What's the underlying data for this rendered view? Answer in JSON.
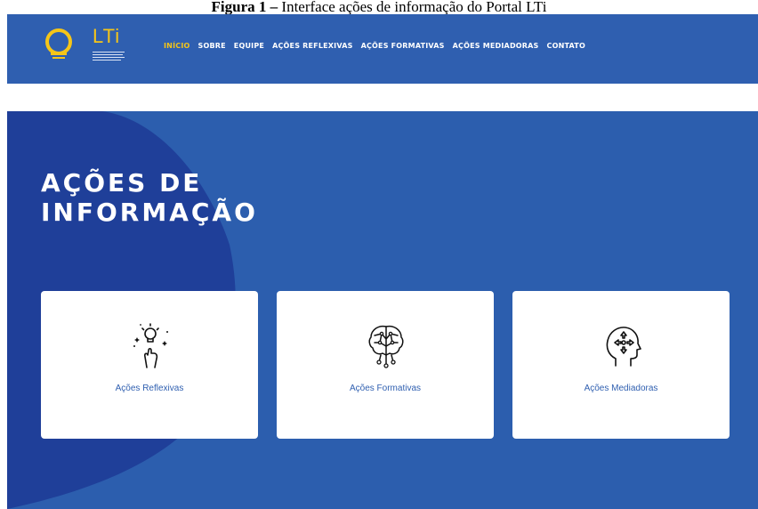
{
  "caption": {
    "bold": "Figura 1 –",
    "text": " Interface ações de informação do Portal LTi"
  },
  "colors": {
    "nav_bg": "#2f5fb0",
    "hero_bg": "#2c5eae",
    "hero_shape": "#1f3f99",
    "accent": "#f5c518",
    "card_text": "#2f5fb0"
  },
  "logo": {
    "text": "LTi",
    "icon": "lightbulb-icon"
  },
  "nav": {
    "items": [
      {
        "label": "INÍCIO",
        "active": true
      },
      {
        "label": "SOBRE"
      },
      {
        "label": "EQUIPE"
      },
      {
        "label": "AÇÕES REFLEXIVAS"
      },
      {
        "label": "AÇÕES FORMATIVAS"
      },
      {
        "label": "AÇÕES MEDIADORAS"
      },
      {
        "label": "CONTATO"
      }
    ]
  },
  "hero": {
    "title_line1": "AÇÕES DE",
    "title_line2": "INFORMAÇÃO"
  },
  "cards": [
    {
      "label": "Ações Reflexivas",
      "icon": "lightbulb-hand-icon"
    },
    {
      "label": "Ações Formativas",
      "icon": "brain-network-icon"
    },
    {
      "label": "Ações Mediadoras",
      "icon": "head-arrows-icon"
    }
  ]
}
